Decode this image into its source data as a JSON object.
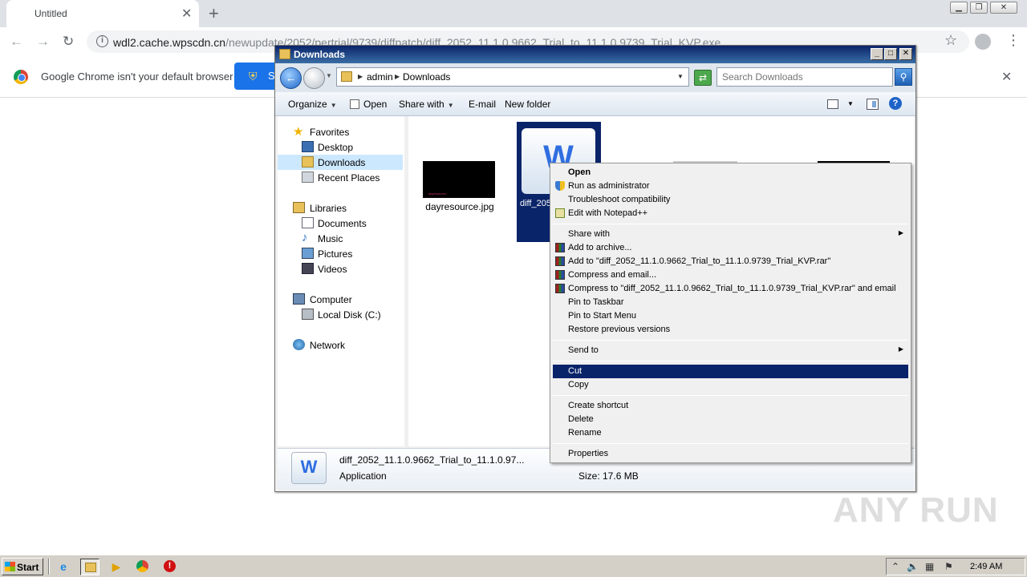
{
  "chrome": {
    "tab_title": "Untitled",
    "tab_close": "✕",
    "new_tab": "+",
    "url_host": "wdl2.cache.wpscdn.cn",
    "url_path": "/newupdate/2052/pertrial/9739/diffpatch/diff_2052_11.1.0.9662_Trial_to_11.1.0.9739_Trial_KVP.exe",
    "infobar_text": "Google Chrome isn't your default browser",
    "infobar_button_label": "S",
    "infobar_close": "✕",
    "window_controls": [
      "▁",
      "❐",
      "✕"
    ]
  },
  "explorer": {
    "title": "Downloads",
    "breadcrumb": [
      "admin",
      "Downloads"
    ],
    "search_placeholder": "Search Downloads",
    "commands": {
      "organize": "Organize",
      "open": "Open",
      "share_with": "Share with",
      "email": "E-mail",
      "new_folder": "New folder"
    },
    "nav": {
      "favorites": "Favorites",
      "desktop": "Desktop",
      "downloads": "Downloads",
      "recent_places": "Recent Places",
      "libraries": "Libraries",
      "documents": "Documents",
      "music": "Music",
      "pictures": "Pictures",
      "videos": "Videos",
      "computer": "Computer",
      "local_disk": "Local Disk (C:)",
      "network": "Network"
    },
    "files": {
      "dayresource": "dayresource.jpg",
      "dayresource_thumb_text": "dayresource",
      "diff_label": "diff_2052_11.1.0.9662_Trial_to_11.1.0.9739_..."
    },
    "details": {
      "name": "diff_2052_11.1.0.9662_Trial_to_11.1.0.97...",
      "type": "Application",
      "size": "Size: 17.6 MB"
    }
  },
  "context_menu": {
    "open": "Open",
    "run_as_admin": "Run as administrator",
    "troubleshoot": "Troubleshoot compatibility",
    "edit_notepad": "Edit with Notepad++",
    "share_with": "Share with",
    "add_archive": "Add to archive...",
    "add_to_rar": "Add to \"diff_2052_11.1.0.9662_Trial_to_11.1.0.9739_Trial_KVP.rar\"",
    "compress_email": "Compress and email...",
    "compress_rar_email": "Compress to \"diff_2052_11.1.0.9662_Trial_to_11.1.0.9739_Trial_KVP.rar\" and email",
    "pin_taskbar": "Pin to Taskbar",
    "pin_start": "Pin to Start Menu",
    "restore_versions": "Restore previous versions",
    "send_to": "Send to",
    "cut": "Cut",
    "copy": "Copy",
    "create_shortcut": "Create shortcut",
    "delete": "Delete",
    "rename": "Rename",
    "properties": "Properties"
  },
  "watermark": "ANY RUN",
  "taskbar": {
    "start": "Start",
    "clock": "2:49 AM"
  }
}
